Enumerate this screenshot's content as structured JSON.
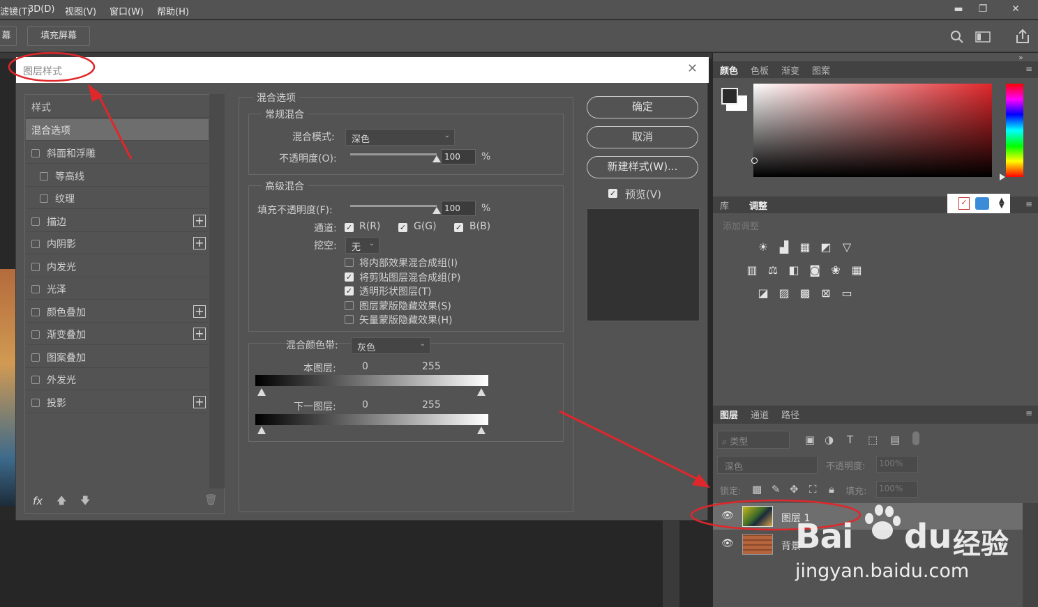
{
  "menu": [
    "滤镜(T)",
    "3D(D)",
    "视图(V)",
    "窗口(W)",
    "帮助(H)"
  ],
  "window_controls": {
    "minimize": "▬",
    "restore": "❐",
    "close": "✕"
  },
  "options_bar": {
    "btn_fit": "幕",
    "btn_fill": "填充屏幕"
  },
  "dialog": {
    "title": "图层样式",
    "close": "✕",
    "styles_header": "样式",
    "blend_options_item": "混合选项",
    "style_items": [
      {
        "label": "斜面和浮雕",
        "plus": false,
        "indent": false
      },
      {
        "label": "等高线",
        "plus": false,
        "indent": true
      },
      {
        "label": "纹理",
        "plus": false,
        "indent": true
      },
      {
        "label": "描边",
        "plus": true,
        "indent": false
      },
      {
        "label": "内阴影",
        "plus": true,
        "indent": false
      },
      {
        "label": "内发光",
        "plus": false,
        "indent": false
      },
      {
        "label": "光泽",
        "plus": false,
        "indent": false
      },
      {
        "label": "颜色叠加",
        "plus": true,
        "indent": false
      },
      {
        "label": "渐变叠加",
        "plus": true,
        "indent": false
      },
      {
        "label": "图案叠加",
        "plus": false,
        "indent": false
      },
      {
        "label": "外发光",
        "plus": false,
        "indent": false
      },
      {
        "label": "投影",
        "plus": true,
        "indent": false
      }
    ],
    "fx_label": "fx",
    "blend_options": {
      "title": "混合选项",
      "general": {
        "title": "常规混合",
        "mode_label": "混合模式:",
        "mode_value": "深色",
        "opacity_label": "不透明度(O):",
        "opacity_value": "100",
        "opacity_unit": "%",
        "opacity_level": 1
      },
      "advanced": {
        "title": "高级混合",
        "fill_label": "填充不透明度(F):",
        "fill_value": "100",
        "fill_unit": "%",
        "fill_level": 1,
        "channels_label": "通道:",
        "channels": [
          "R(R)",
          "G(G)",
          "B(B)"
        ],
        "knockout_label": "挖空:",
        "knockout_value": "无",
        "options": [
          {
            "label": "将内部效果混合成组(I)",
            "checked": false
          },
          {
            "label": "将剪贴图层混合成组(P)",
            "checked": true
          },
          {
            "label": "透明形状图层(T)",
            "checked": true
          },
          {
            "label": "图层蒙版隐藏效果(S)",
            "checked": false
          },
          {
            "label": "矢量蒙版隐藏效果(H)",
            "checked": false
          }
        ]
      },
      "blend_if": {
        "label": "混合颜色带:",
        "value": "灰色",
        "this_layer": "本图层:",
        "below_layer": "下一图层:",
        "min": "0",
        "max": "255"
      }
    },
    "ok": "确定",
    "cancel": "取消",
    "new_style": "新建样式(W)...",
    "preview": "预览(V)"
  },
  "panels": {
    "color_tabs": [
      "颜色",
      "色板",
      "渐变",
      "图案"
    ],
    "adjust_tabs": [
      "库",
      "调整"
    ],
    "add_adjustment": "添加调整",
    "layers_tabs": [
      "图层",
      "通道",
      "路径"
    ],
    "filter_kind": "类型",
    "blend_mode": "深色",
    "opacity_label": "不透明度:",
    "opacity_value": "100%",
    "lock_label": "锁定:",
    "fill_label": "填充:",
    "fill_value": "100%",
    "layers": [
      {
        "name": "图层 1",
        "selected": true,
        "locked": false
      },
      {
        "name": "背景",
        "selected": false,
        "locked": true
      }
    ]
  },
  "watermark": {
    "brand": "Bai",
    "du": "du",
    "cn": "经验",
    "url": "jingyan.baidu.com"
  },
  "colors": {
    "accent_red": "#e0272b",
    "panel": "#535353",
    "dark": "#282828"
  }
}
